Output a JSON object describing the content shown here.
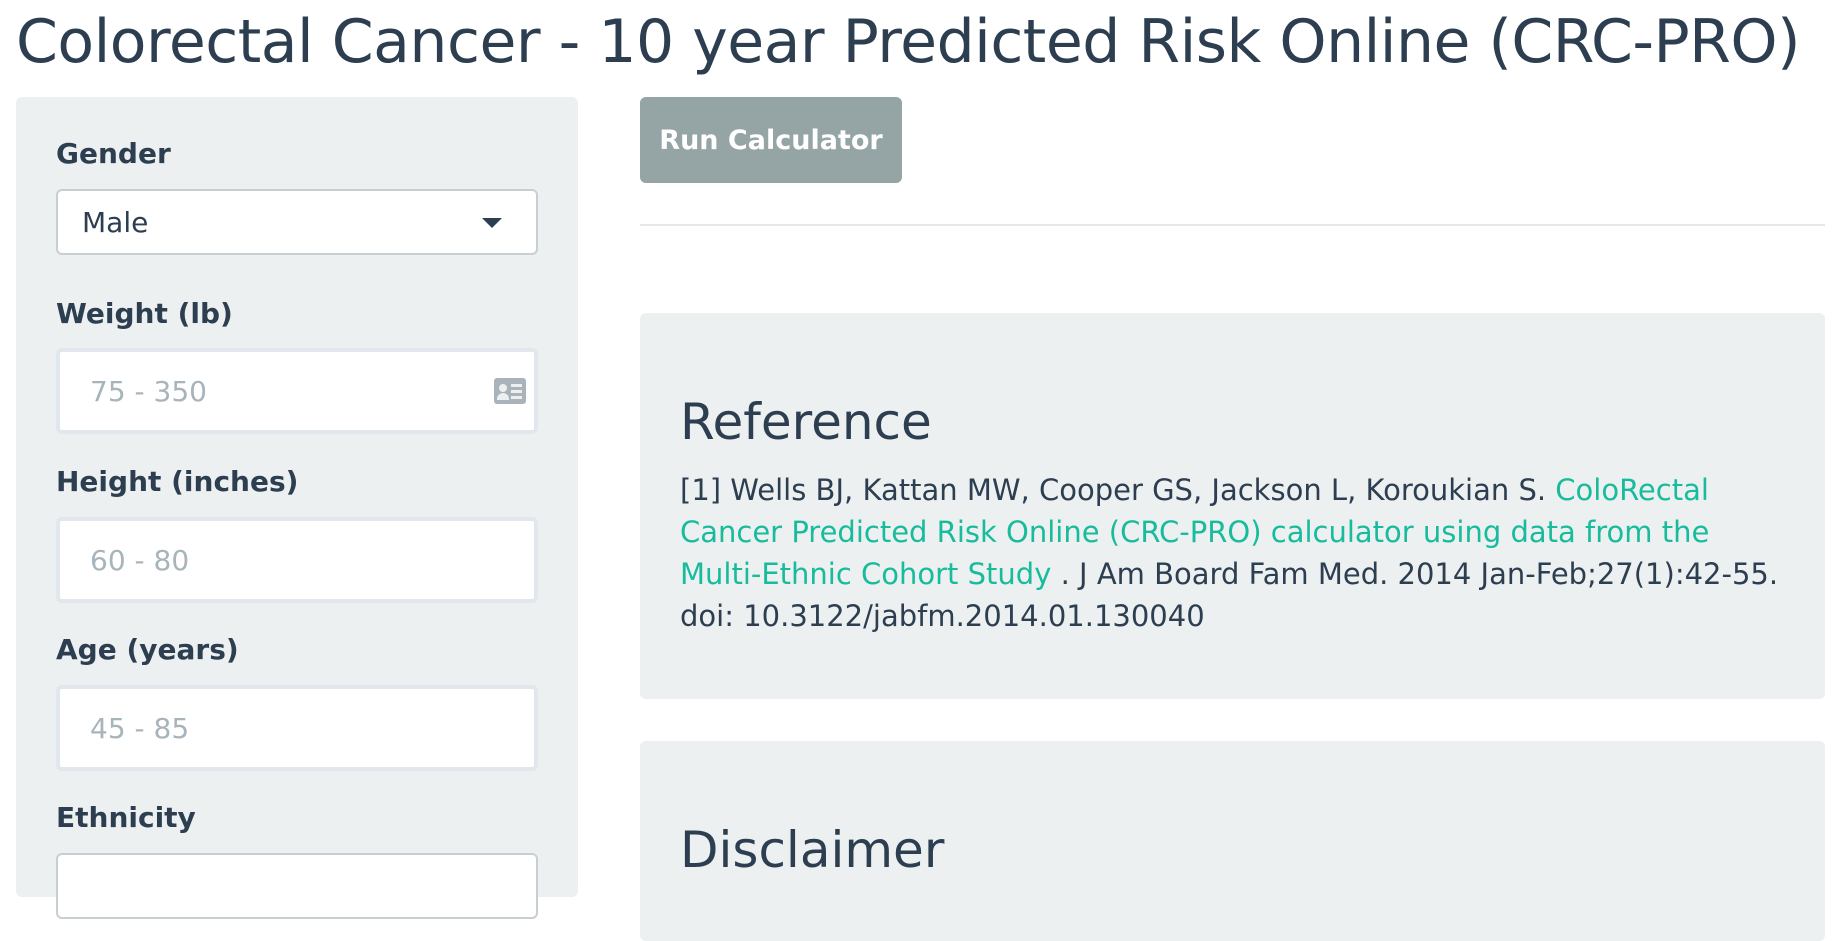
{
  "title": "Colorectal Cancer - 10 year Predicted Risk Online (CRC-PRO)",
  "sidebar": {
    "gender": {
      "label": "Gender",
      "selected": "Male"
    },
    "weight": {
      "label": "Weight (lb)",
      "placeholder": "75 - 350",
      "value": ""
    },
    "height": {
      "label": "Height (inches)",
      "placeholder": "60 - 80",
      "value": ""
    },
    "age": {
      "label": "Age (years)",
      "placeholder": "45 - 85",
      "value": ""
    },
    "ethnicity": {
      "label": "Ethnicity"
    }
  },
  "main": {
    "run_button_label": "Run Calculator",
    "reference": {
      "heading": "Reference",
      "text_before": "[1] Wells BJ, Kattan MW, Cooper GS, Jackson L, Koroukian S. ",
      "link_text": "ColoRectal Cancer Predicted Risk Online (CRC-PRO) calculator using data from the Multi-Ethnic Cohort Study",
      "text_after": " . J Am Board Fam Med. 2014 Jan-Feb;27(1):42-55. doi: 10.3122/jabfm.2014.01.130040"
    },
    "disclaimer": {
      "heading": "Disclaimer"
    }
  },
  "colors": {
    "primary_text": "#2c3e50",
    "panel_background": "#ecf0f1",
    "button_background": "#95a5a6",
    "link": "#18bc9c"
  }
}
